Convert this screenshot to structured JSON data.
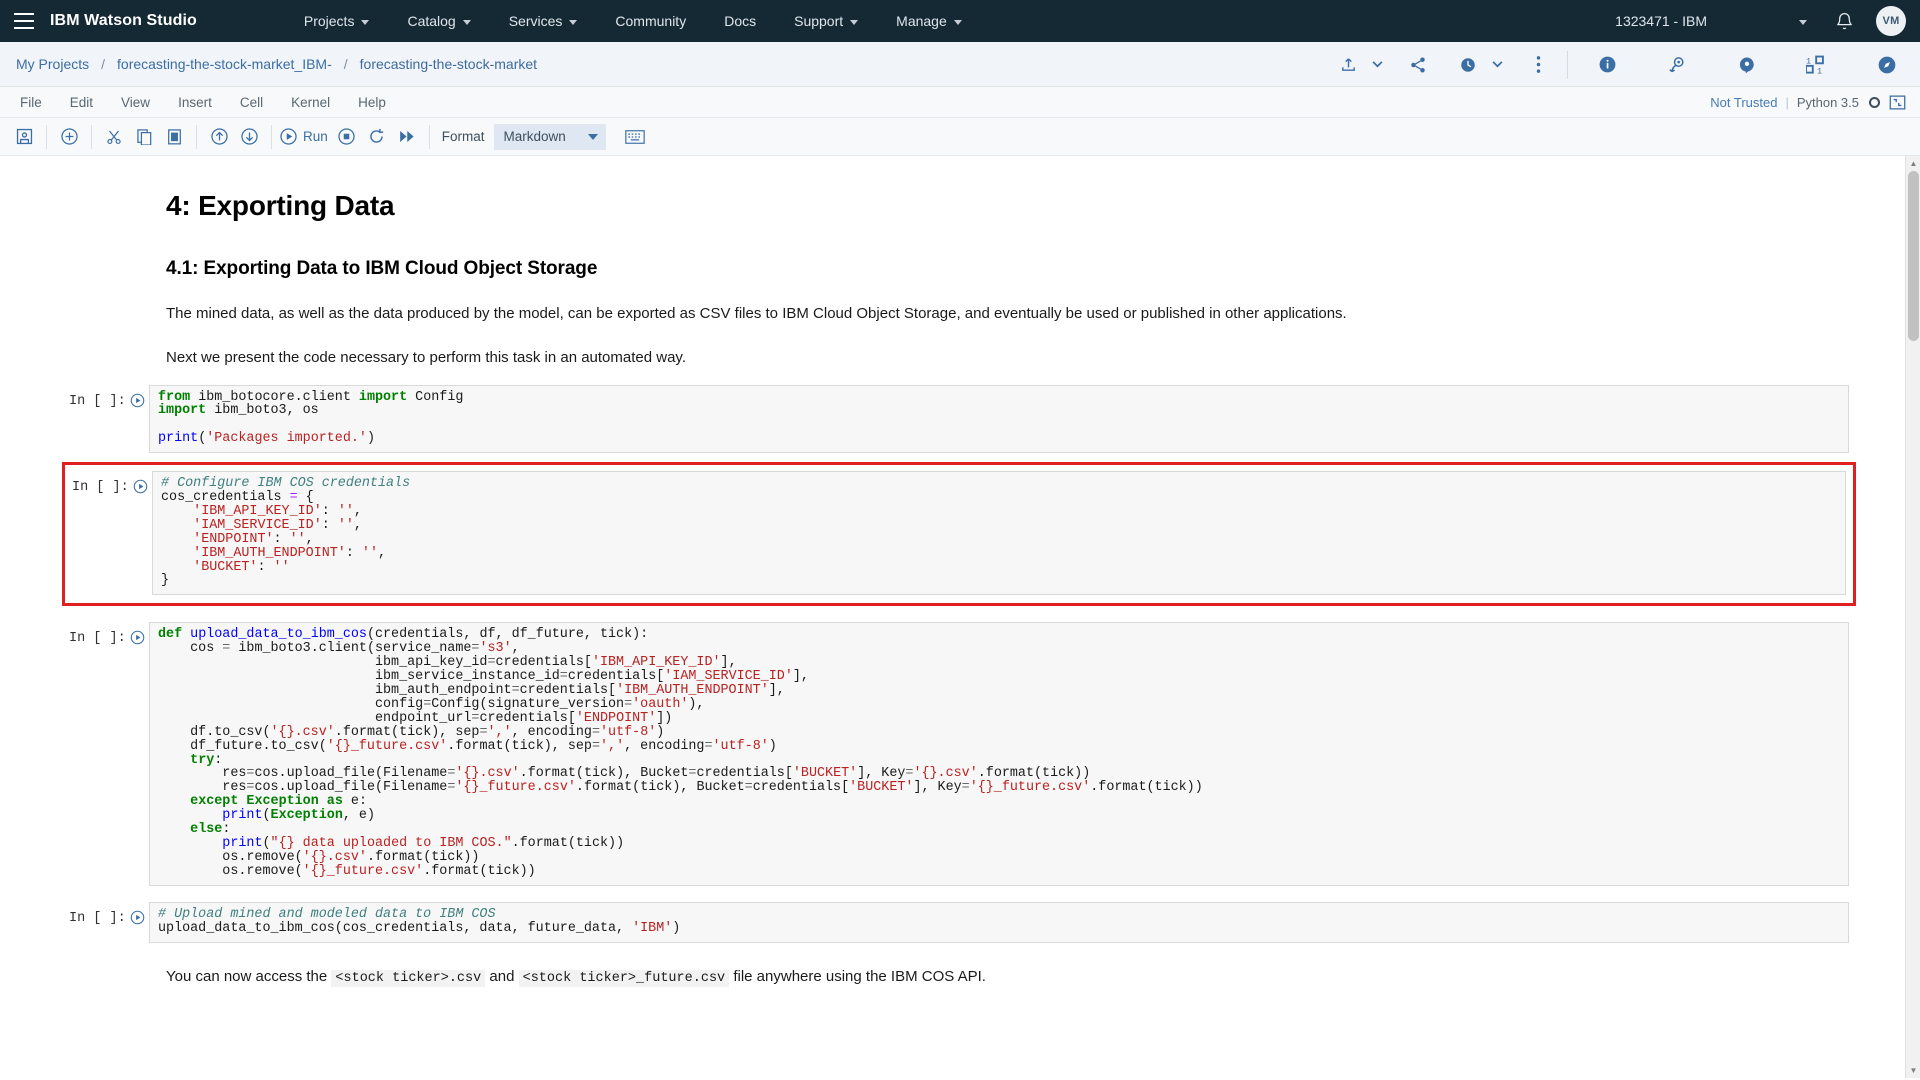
{
  "masthead": {
    "brand": "IBM Watson Studio",
    "menu_icon": "hamburger-icon",
    "nav": [
      {
        "label": "Projects",
        "caret": true
      },
      {
        "label": "Catalog",
        "caret": true
      },
      {
        "label": "Services",
        "caret": true
      },
      {
        "label": "Community",
        "caret": false
      },
      {
        "label": "Docs",
        "caret": false
      },
      {
        "label": "Support",
        "caret": true
      },
      {
        "label": "Manage",
        "caret": true
      }
    ],
    "account": "1323471 - IBM",
    "avatar_initials": "VM",
    "bg_color": "#152935"
  },
  "breadcrumb": {
    "items": [
      {
        "label": "My Projects"
      },
      {
        "label": "forecasting-the-stock-market_IBM-"
      },
      {
        "label": "forecasting-the-stock-market"
      }
    ],
    "separator": "/",
    "tools": [
      "upload-icon",
      "chevron-down-icon",
      "share-icon",
      "history-icon",
      "chevron-down-icon",
      "overflow-menu-icon"
    ],
    "right_tools": [
      "info-icon",
      "find-data-icon",
      "comment-icon",
      "code-snippets-icon",
      "compass-icon"
    ],
    "accent_color": "#3b6ea5"
  },
  "menubar": {
    "items": [
      "File",
      "Edit",
      "View",
      "Insert",
      "Cell",
      "Kernel",
      "Help"
    ],
    "trust_status": "Not Trusted",
    "separator": "|",
    "kernel": "Python 3.5",
    "kernel_indicator": "kernel-idle-circle",
    "expand_icon": "expand-icon"
  },
  "toolbar": {
    "buttons": [
      "save-icon",
      "add-cell-icon",
      "cut-icon",
      "copy-icon",
      "paste-icon",
      "move-up-icon",
      "move-down-icon"
    ],
    "run_label": "Run",
    "run_icon": "run-icon",
    "stop_icon": "stop-icon",
    "restart_icon": "restart-icon",
    "restart_run_all_icon": "fast-forward-icon",
    "format_label": "Format",
    "format_value": "Markdown",
    "keyboard_icon": "keyboard-icon"
  },
  "notebook": {
    "heading1": "4: Exporting Data",
    "heading2": "4.1: Exporting Data to IBM Cloud Object Storage",
    "paragraph1": "The mined data, as well as the data produced by the model, can be exported as CSV files to IBM Cloud Object Storage, and eventually be used or published in other applications.",
    "paragraph2": "Next we present the code necessary to perform this task in an automated way.",
    "footer_text_a": "You can now access the",
    "footer_code_a": "<stock ticker>.csv",
    "footer_text_b": "and",
    "footer_code_b": "<stock ticker>_future.csv",
    "footer_text_c": "file anywhere using the IBM COS API.",
    "prompt_label": "In [ ]:",
    "cells": [
      {
        "id": "cell-imports",
        "highlighted": false,
        "code": "from ibm_botocore.client import Config\nimport ibm_boto3, os\n\nprint('Packages imported.')"
      },
      {
        "id": "cell-credentials",
        "highlighted": true,
        "code": "# Configure IBM COS credentials\ncos_credentials = {\n    'IBM_API_KEY_ID': '',\n    'IAM_SERVICE_ID': '',\n    'ENDPOINT': '',\n    'IBM_AUTH_ENDPOINT': '',\n    'BUCKET': ''\n}"
      },
      {
        "id": "cell-upload-function",
        "highlighted": false,
        "code": "def upload_data_to_ibm_cos(credentials, df, df_future, tick):\n    cos = ibm_boto3.client(service_name='s3',\n                           ibm_api_key_id=credentials['IBM_API_KEY_ID'],\n                           ibm_service_instance_id=credentials['IAM_SERVICE_ID'],\n                           ibm_auth_endpoint=credentials['IBM_AUTH_ENDPOINT'],\n                           config=Config(signature_version='oauth'),\n                           endpoint_url=credentials['ENDPOINT'])\n    df.to_csv('{}.csv'.format(tick), sep=',', encoding='utf-8')\n    df_future.to_csv('{}_future.csv'.format(tick), sep=',', encoding='utf-8')\n    try:\n        res=cos.upload_file(Filename='{}.csv'.format(tick), Bucket=credentials['BUCKET'], Key='{}.csv'.format(tick))\n        res=cos.upload_file(Filename='{}_future.csv'.format(tick), Bucket=credentials['BUCKET'], Key='{}_future.csv'.format(tick))\n    except Exception as e:\n        print(Exception, e)\n    else:\n        print(\"{} data uploaded to IBM COS.\".format(tick))\n        os.remove('{}.csv'.format(tick))\n        os.remove('{}_future.csv'.format(tick))"
      },
      {
        "id": "cell-upload-call",
        "highlighted": false,
        "code": "# Upload mined and modeled data to IBM COS\nupload_data_to_ibm_cos(cos_credentials, data, future_data, 'IBM')"
      }
    ],
    "highlight_color": "#e02020"
  }
}
